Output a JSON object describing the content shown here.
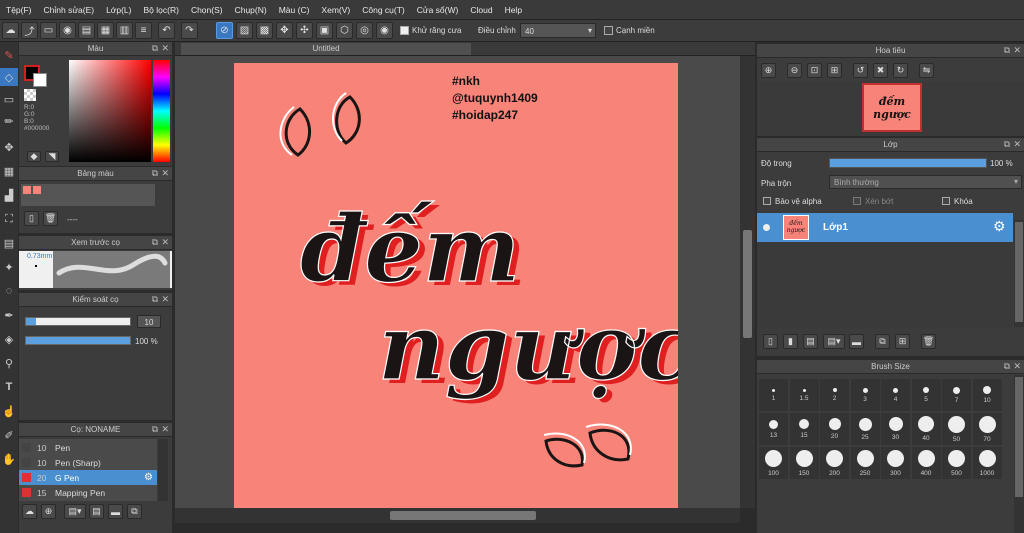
{
  "menu": [
    "Tệp(F)",
    "Chỉnh sửa(E)",
    "Lớp(L)",
    "Bộ lọc(R)",
    "Chọn(S)",
    "Chụp(N)",
    "Màu (C)",
    "Xem(V)",
    "Công cụ(T)",
    "Cửa sổ(W)",
    "Cloud",
    "Help"
  ],
  "toolbar": {
    "antialias_label": "Khử răng cưa",
    "adjust_label": "Điều chỉnh",
    "adjust_value": "40",
    "edge_label": "Cạnh miền"
  },
  "color_panel": {
    "title": "Màu",
    "r": "R:0",
    "g": "G:0",
    "b": "B:0",
    "hex": "#000000"
  },
  "palette_panel": {
    "title": "Bảng màu",
    "empty": "----"
  },
  "preview_panel": {
    "title": "Xem trước cọ",
    "size": "0.73mm"
  },
  "brush_control": {
    "title": "Kiểm soát cọ",
    "size_value": "10",
    "opacity_value": "100 %",
    "size_fraction": 0.1,
    "opacity_fraction": 1.0
  },
  "brush_list": {
    "title": "Cọ: NONAME",
    "items": [
      {
        "size": "10",
        "name": "Pen",
        "color": "#444444",
        "selected": false
      },
      {
        "size": "10",
        "name": "Pen (Sharp)",
        "color": "#444444",
        "selected": false
      },
      {
        "size": "20",
        "name": "G Pen",
        "color": "#e03030",
        "selected": true
      },
      {
        "size": "15",
        "name": "Mapping Pen",
        "color": "#e03030",
        "selected": false
      }
    ]
  },
  "canvas": {
    "tab_title": "Untitled",
    "background": "#f88479",
    "tags": [
      "#nkh",
      "@tuquynh1409",
      "#hoidap247"
    ],
    "word1": "đếm",
    "word2": "ngược"
  },
  "navigator": {
    "title": "Hoa tiêu",
    "thumb_line1": "đếm",
    "thumb_line2": "ngược"
  },
  "layer_panel": {
    "title": "Lớp",
    "opacity_label": "Độ trong",
    "opacity_value": "100 %",
    "opacity_fraction": 1.0,
    "blend_label": "Pha trộn",
    "blend_value": "Bình thường",
    "protect_alpha": "Bảo vệ alpha",
    "clipping": "Xén bớt",
    "lock": "Khóa",
    "layers": [
      {
        "name": "Lớp1",
        "thumb_line1": "đếm",
        "thumb_line2": "ngược"
      }
    ]
  },
  "brush_size": {
    "title": "Brush Size",
    "sizes": [
      "1",
      "1.5",
      "2",
      "3",
      "4",
      "5",
      "7",
      "10",
      "13",
      "15",
      "20",
      "25",
      "30",
      "40",
      "50",
      "70",
      "100",
      "150",
      "200",
      "250",
      "300",
      "400",
      "500",
      "1000"
    ]
  },
  "colors": {
    "accent": "#3a78c2",
    "selected_row": "#4a90d0",
    "canvas_bg": "#f88479",
    "ink": "#1a1414",
    "shadow": "#e02020"
  }
}
